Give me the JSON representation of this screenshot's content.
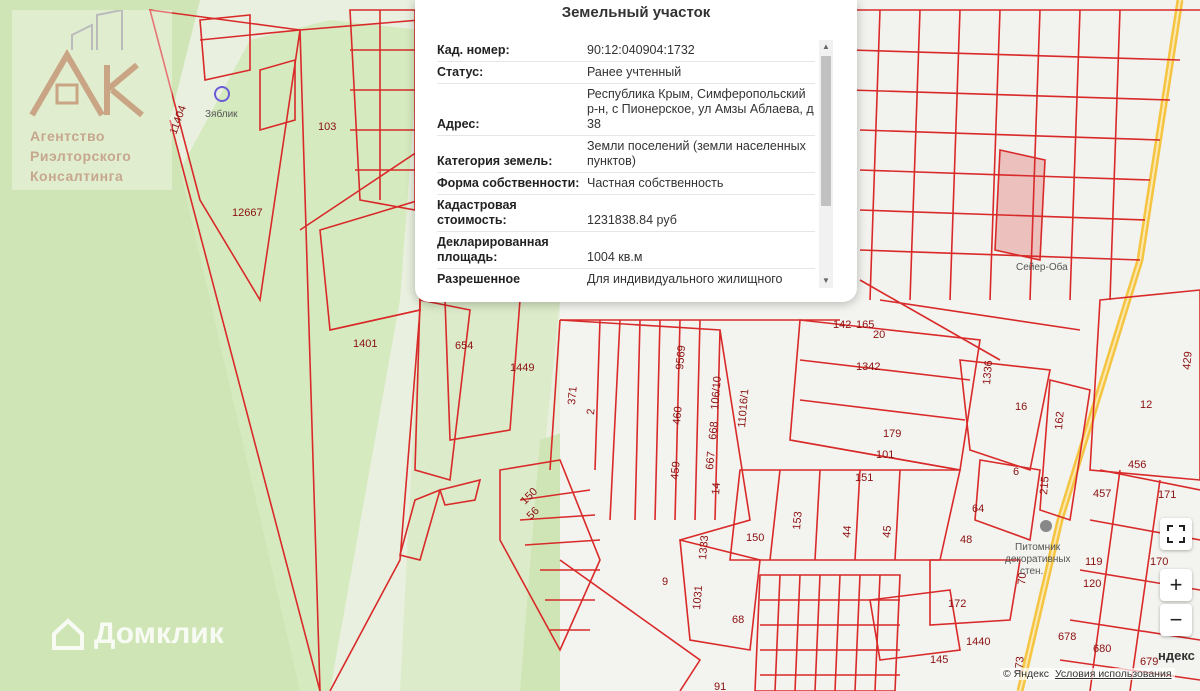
{
  "popup": {
    "title": "Земельный участок",
    "rows": [
      {
        "key": "Кад. номер:",
        "value": "90:12:040904:1732"
      },
      {
        "key": "Статус:",
        "value": "Ранее учтенный"
      },
      {
        "key": "Адрес:",
        "value": "Республика Крым, Симферопольский р-н, с Пионерское, ул Амзы Аблаева, д 38"
      },
      {
        "key": "Категория земель:",
        "value": "Земли поселений (земли населенных пунктов)"
      },
      {
        "key": "Форма собственности:",
        "value": "Частная собственность"
      },
      {
        "key": "Кадастровая стоимость:",
        "value": "1231838.84 руб"
      },
      {
        "key": "Декларированная площадь:",
        "value": "1004 кв.м"
      },
      {
        "key": "Разрешенное",
        "value": "Для индивидуального жилищного"
      }
    ]
  },
  "watermark": {
    "logo_letters": "ARK",
    "line1": "Агентство",
    "line2": "Риэлторского",
    "line3": "Консалтинга",
    "domclick": "Домклик"
  },
  "map_labels": {
    "plots": [
      "11404",
      "103",
      "12667",
      "1401",
      "654",
      "1449",
      "371",
      "2",
      "9569",
      "460",
      "106/10",
      "11016/1",
      "668",
      "459",
      "667",
      "14",
      "142",
      "165",
      "20",
      "1342",
      "1336",
      "16",
      "162",
      "179",
      "101",
      "151",
      "6",
      "64",
      "48",
      "150",
      "153",
      "44",
      "45",
      "215",
      "1031",
      "9",
      "1333",
      "68",
      "172",
      "1440",
      "145",
      "150",
      "56",
      "456",
      "457",
      "171",
      "170",
      "119",
      "120",
      "678",
      "680",
      "679",
      "429",
      "91",
      "173",
      "70",
      "12"
    ],
    "streets": [
      "Сейер-Оба",
      "Питомник декоративных стен.",
      "Зяблик"
    ],
    "brand": "ндекс"
  },
  "controls": {
    "fullscreen": "⛶",
    "zoom_in": "+",
    "zoom_out": "−"
  },
  "copyright": {
    "yandex": "© Яндекс",
    "terms": "Условия использования"
  },
  "colors": {
    "plot_border": "#d92a2a",
    "forest": "#cfe5b5",
    "road": "#f5c542"
  }
}
